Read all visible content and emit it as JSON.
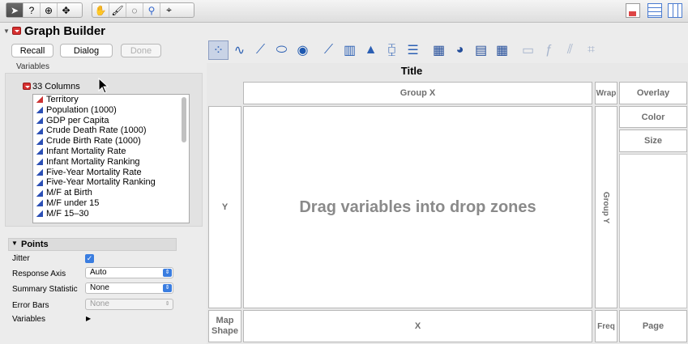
{
  "toolbar": {
    "left_tools": [
      "arrow-tool",
      "help-tool",
      "selection-tool",
      "grabber-tool"
    ],
    "right_tools": [
      "hand-tool",
      "brush-tool",
      "lasso-tool",
      "magnifier-tool",
      "crosshair-tool"
    ],
    "window_tools": [
      "report-icon",
      "table-icon",
      "columns-icon"
    ]
  },
  "header": {
    "title": "Graph Builder"
  },
  "buttons": {
    "recall": "Recall",
    "dialog": "Dialog",
    "done": "Done"
  },
  "variables": {
    "section_label": "Variables",
    "columns_label": "33 Columns",
    "items": [
      "Territory",
      "Population (1000)",
      "GDP per Capita",
      "Crude Death Rate (1000)",
      "Crude Birth Rate (1000)",
      "Infant Mortality Rate",
      "Infant Mortality Ranking",
      "Five-Year Mortality Rate",
      "Five-Year Mortality Ranking",
      "M/F at Birth",
      "M/F under 15",
      "M/F 15–30"
    ]
  },
  "points": {
    "title": "Points",
    "jitter_label": "Jitter",
    "jitter_checked": true,
    "response_axis_label": "Response Axis",
    "response_axis_value": "Auto",
    "summary_stat_label": "Summary Statistic",
    "summary_stat_value": "None",
    "error_bars_label": "Error Bars",
    "error_bars_value": "None",
    "variables_label": "Variables"
  },
  "graph": {
    "title": "Title",
    "group_x": "Group X",
    "group_y": "Group Y",
    "wrap": "Wrap",
    "overlay": "Overlay",
    "color": "Color",
    "size": "Size",
    "y": "Y",
    "x": "X",
    "map_shape": "Map\nShape",
    "freq": "Freq",
    "page": "Page",
    "placeholder": "Drag variables into drop zones"
  },
  "graph_types": [
    "points",
    "smoother",
    "line-of-fit",
    "ellipse",
    "contour",
    "line",
    "bar",
    "area",
    "box-plot",
    "histogram",
    "heatmap",
    "pie",
    "treemap",
    "mosaic",
    "caption-box",
    "formula",
    "parallel",
    "map"
  ]
}
